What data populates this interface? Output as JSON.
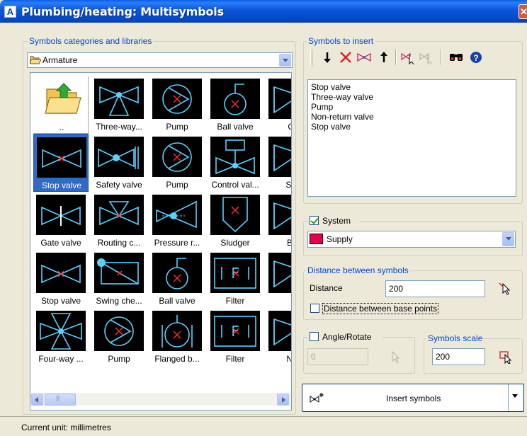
{
  "window": {
    "title": "Plumbing/heating: Multisymbols",
    "close_glyph": "✕"
  },
  "categories": {
    "legend": "Symbols categories and libraries",
    "selected": "Armature",
    "tiles": [
      {
        "label": "..",
        "icon": "folder-up-icon",
        "state": "raised"
      },
      {
        "label": "Three-way...",
        "icon": "three-way-valve-icon",
        "state": "normal"
      },
      {
        "label": "Pump",
        "icon": "pump-icon",
        "state": "normal"
      },
      {
        "label": "Ball valve",
        "icon": "ball-valve-icon",
        "state": "normal"
      },
      {
        "label": "Ca",
        "icon": "valve-icon",
        "state": "normal"
      },
      {
        "label": "Stop valve",
        "icon": "stop-valve-icon",
        "state": "selected"
      },
      {
        "label": "Safety valve",
        "icon": "safety-valve-icon",
        "state": "normal"
      },
      {
        "label": "Pump",
        "icon": "pump-icon",
        "state": "normal"
      },
      {
        "label": "Control val...",
        "icon": "control-valve-icon",
        "state": "normal"
      },
      {
        "label": "Shu",
        "icon": "valve-icon",
        "state": "normal"
      },
      {
        "label": "Gate valve",
        "icon": "gate-valve-icon",
        "state": "normal"
      },
      {
        "label": "Routing c...",
        "icon": "routing-valve-icon",
        "state": "normal"
      },
      {
        "label": "Pressure r...",
        "icon": "pressure-reducer-icon",
        "state": "normal"
      },
      {
        "label": "Sludger",
        "icon": "sludger-icon",
        "state": "normal"
      },
      {
        "label": "But",
        "icon": "valve-icon",
        "state": "normal"
      },
      {
        "label": "Stop valve",
        "icon": "stop-valve-icon",
        "state": "normal"
      },
      {
        "label": "Swing che...",
        "icon": "swing-check-icon",
        "state": "normal"
      },
      {
        "label": "Ball valve",
        "icon": "ball-valve-icon",
        "state": "normal"
      },
      {
        "label": "Filter",
        "icon": "filter-icon",
        "state": "normal"
      },
      {
        "label": "S",
        "icon": "valve-icon",
        "state": "normal"
      },
      {
        "label": "Four-way ...",
        "icon": "four-way-valve-icon",
        "state": "normal"
      },
      {
        "label": "Pump",
        "icon": "pump-icon",
        "state": "normal"
      },
      {
        "label": "Flanged b...",
        "icon": "flanged-valve-icon",
        "state": "normal"
      },
      {
        "label": "Filter",
        "icon": "filter-icon",
        "state": "normal"
      },
      {
        "label": "Nor",
        "icon": "valve-icon",
        "state": "normal"
      }
    ],
    "scroll_thumb_glyph": "III"
  },
  "symbols_to_insert": {
    "legend": "Symbols to insert",
    "toolbar": [
      {
        "name": "move-down-icon",
        "glyph": "🡓"
      },
      {
        "name": "delete-icon",
        "glyph": "✕"
      },
      {
        "name": "symbol-icon",
        "glyph": "⋈"
      },
      {
        "name": "move-up-icon",
        "glyph": "🡑"
      },
      {
        "name": "pick-symbol-icon",
        "glyph": "⋈"
      },
      {
        "name": "pick-symbol-disabled-icon",
        "glyph": "⋈"
      },
      {
        "name": "binoculars-icon",
        "glyph": "👓"
      },
      {
        "name": "help-icon",
        "glyph": "?"
      }
    ],
    "items": [
      "Stop valve",
      "Three-way valve",
      "Pump",
      "Non-return valve",
      "Stop valve"
    ]
  },
  "system": {
    "checkbox_label": "System",
    "checked": true,
    "selected": "Supply",
    "swatch_color": "#e8004d"
  },
  "distance": {
    "legend": "Distance between symbols",
    "label": "Distance",
    "value": "200",
    "base_points_label": "Distance between base points",
    "base_points_checked": false
  },
  "angle": {
    "checkbox_label": "Angle/Rotate",
    "checked": false,
    "value": "0"
  },
  "scale": {
    "legend": "Symbols scale",
    "value": "200"
  },
  "insert_button": {
    "label": "Insert symbols"
  },
  "status": {
    "text": "Current unit: millimetres"
  },
  "colors": {
    "accent": "#0046d5",
    "symbol_line": "#5ad0ff",
    "symbol_mark": "#ff3030"
  }
}
